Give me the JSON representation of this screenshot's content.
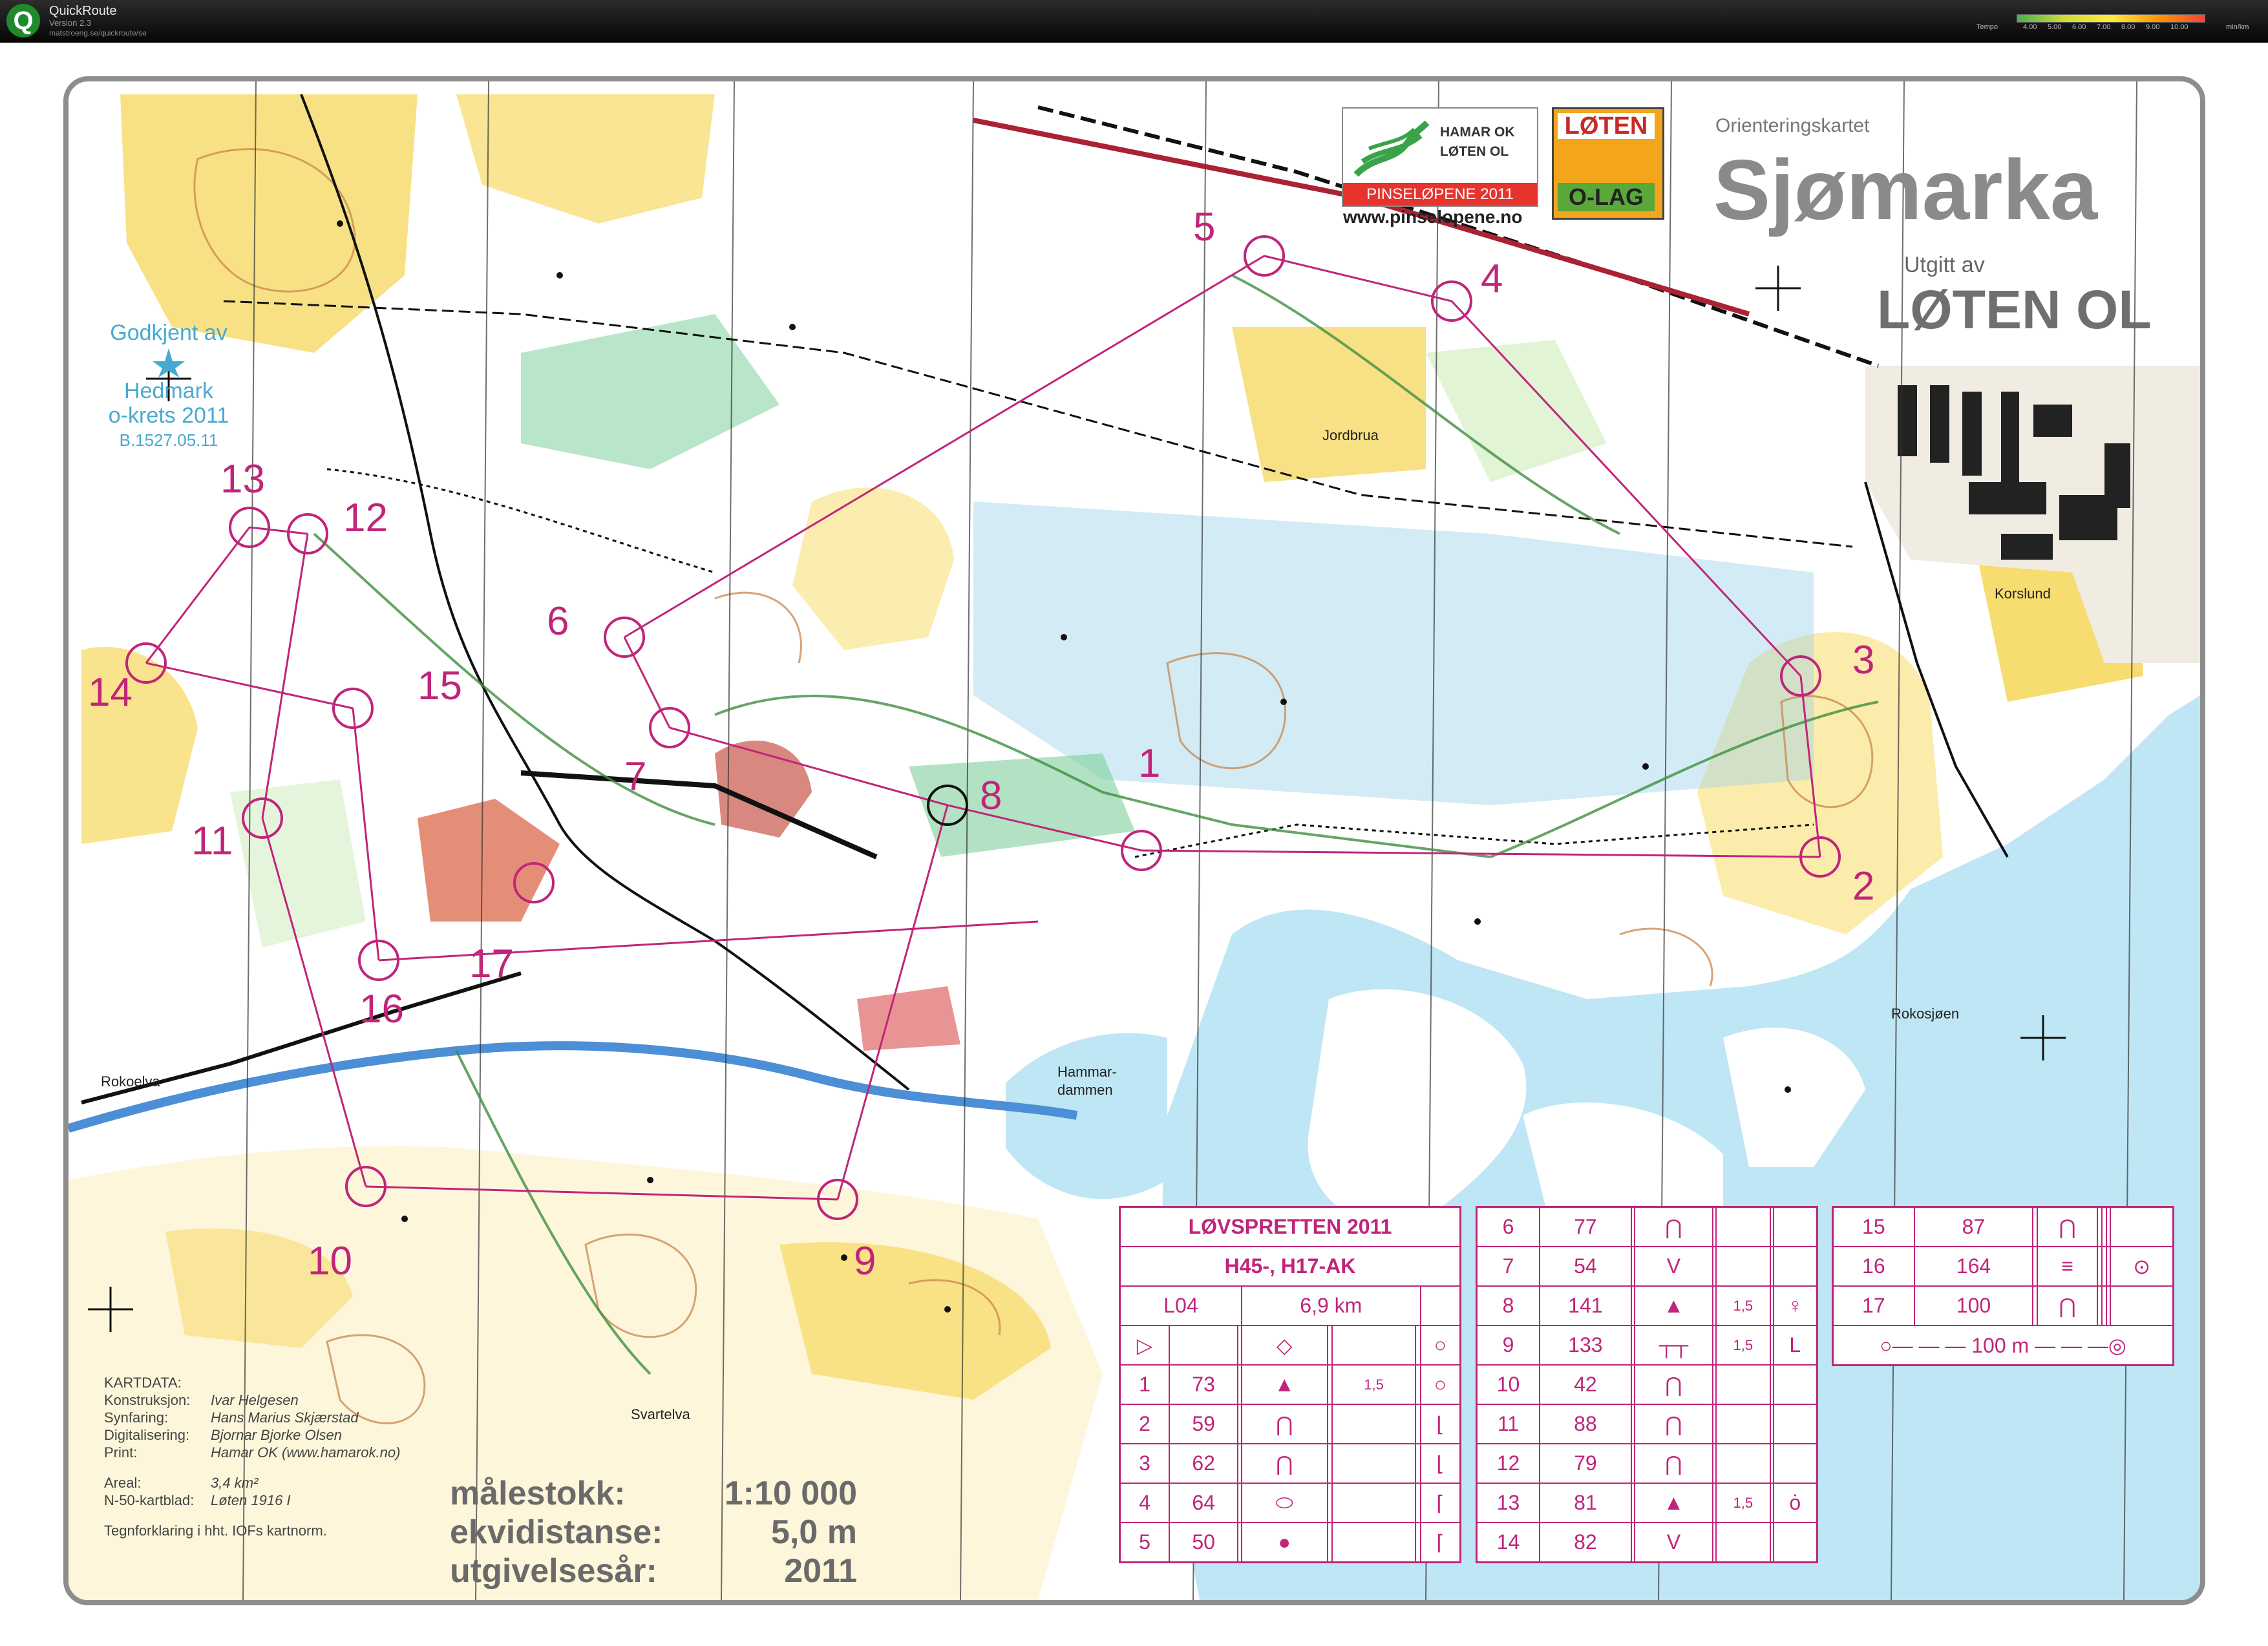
{
  "app": {
    "name": "QuickRoute",
    "version": "Version 2.3",
    "url": "matstroeng.se/quickroute/se",
    "tempo_label": "Tempo",
    "tempo_ticks": [
      "4.00",
      "5.00",
      "6.00",
      "7.00",
      "8.00",
      "9.00",
      "10.00"
    ],
    "tempo_unit": "min/km",
    "colors": {
      "bar_bg": "#141414",
      "tempo_gradient": [
        "#4caf50",
        "#cddc39",
        "#ffeb3b",
        "#ff9800",
        "#f44336"
      ]
    }
  },
  "map": {
    "title_small": "Orienteringskartet",
    "title": "Sjømarka",
    "publisher_label": "Utgitt av",
    "publisher": "LØTEN OL",
    "sponsor_logo": {
      "line1": "HAMAR OK",
      "line2": "LØTEN OL",
      "banner": "PINSELØPENE 2011",
      "url": "www.pinselopene.no"
    },
    "club_logo": {
      "top": "LØTEN",
      "bottom": "O-LAG"
    },
    "approval": {
      "line1": "Godkjent av",
      "line2": "Hedmark",
      "line3": "o-krets 2011",
      "line4": "B.1527.05.11"
    },
    "place_names": [
      "Jordbrua",
      "Korslund",
      "Rokoelva",
      "Hammar-",
      "dammen",
      "Rokosjøen",
      "Svartelva"
    ],
    "control_numbers": [
      "1",
      "2",
      "3",
      "4",
      "5",
      "6",
      "7",
      "8",
      "9",
      "10",
      "11",
      "12",
      "13",
      "14",
      "15",
      "16",
      "17"
    ],
    "colors": {
      "course": "#c0257a",
      "open_land": "#f7dc6f",
      "marsh": "#9ed2e8",
      "water": "#bfe6f5",
      "green": "#7fcf9b",
      "contour": "#c8864d"
    }
  },
  "kartdata": {
    "heading": "KARTDATA:",
    "rows": [
      {
        "key": "Konstruksjon:",
        "value": "Ivar Helgesen"
      },
      {
        "key": "Synfaring:",
        "value": "Hans Marius Skjærstad"
      },
      {
        "key": "Digitalisering:",
        "value": "Bjornar Bjorke Olsen"
      },
      {
        "key": "Print:",
        "value": "Hamar OK (www.hamarok.no)"
      },
      {
        "key": "Areal:",
        "value": "3,4 km²"
      },
      {
        "key": "N-50-kartblad:",
        "value": "Løten 1916 I"
      }
    ],
    "footer": "Tegnforklaring i hht. IOFs kartnorm."
  },
  "scale_info": {
    "rows": [
      {
        "key": "målestokk:",
        "value": "1:10 000"
      },
      {
        "key": "ekvidistanse:",
        "value": "5,0 m"
      },
      {
        "key": "utgivelsesår:",
        "value": "2011"
      }
    ]
  },
  "control_description": {
    "event": "LØVSPRETTEN 2011",
    "classes": "H45-, H17-AK",
    "course": "L04",
    "length": "6,9 km",
    "rows": [
      {
        "n": "1",
        "code": "73",
        "sym": "▲",
        "extra": "1,5",
        "loc": "○"
      },
      {
        "n": "2",
        "code": "59",
        "sym": "⋂",
        "extra": "",
        "loc": "⌊"
      },
      {
        "n": "3",
        "code": "62",
        "sym": "⋂",
        "extra": "",
        "loc": "⌊"
      },
      {
        "n": "4",
        "code": "64",
        "sym": "⬭",
        "extra": "",
        "loc": "⌈"
      },
      {
        "n": "5",
        "code": "50",
        "sym": "●",
        "extra": "",
        "loc": "⌈"
      },
      {
        "n": "6",
        "code": "77",
        "sym": "⋂",
        "extra": "",
        "loc": ""
      },
      {
        "n": "7",
        "code": "54",
        "sym": "V",
        "extra": "",
        "loc": ""
      },
      {
        "n": "8",
        "code": "141",
        "sym": "▲",
        "extra": "1,5",
        "loc": "♀"
      },
      {
        "n": "9",
        "code": "133",
        "sym": "┬┬",
        "extra": "1,5",
        "loc": "L"
      },
      {
        "n": "10",
        "code": "42",
        "sym": "⋂",
        "extra": "",
        "loc": ""
      },
      {
        "n": "11",
        "code": "88",
        "sym": "⋂",
        "extra": "",
        "loc": ""
      },
      {
        "n": "12",
        "code": "79",
        "sym": "⋂",
        "extra": "",
        "loc": ""
      },
      {
        "n": "13",
        "code": "81",
        "sym": "▲",
        "extra": "1,5",
        "loc": "ȯ"
      },
      {
        "n": "14",
        "code": "82",
        "sym": "V",
        "extra": "",
        "loc": ""
      },
      {
        "n": "15",
        "code": "87",
        "sym": "⋂",
        "extra": "",
        "loc": ""
      },
      {
        "n": "16",
        "code": "164",
        "sym": "≡",
        "extra": "",
        "loc": "⊙"
      },
      {
        "n": "17",
        "code": "100",
        "sym": "⋂",
        "extra": "",
        "loc": ""
      }
    ],
    "finish": "100 m"
  }
}
